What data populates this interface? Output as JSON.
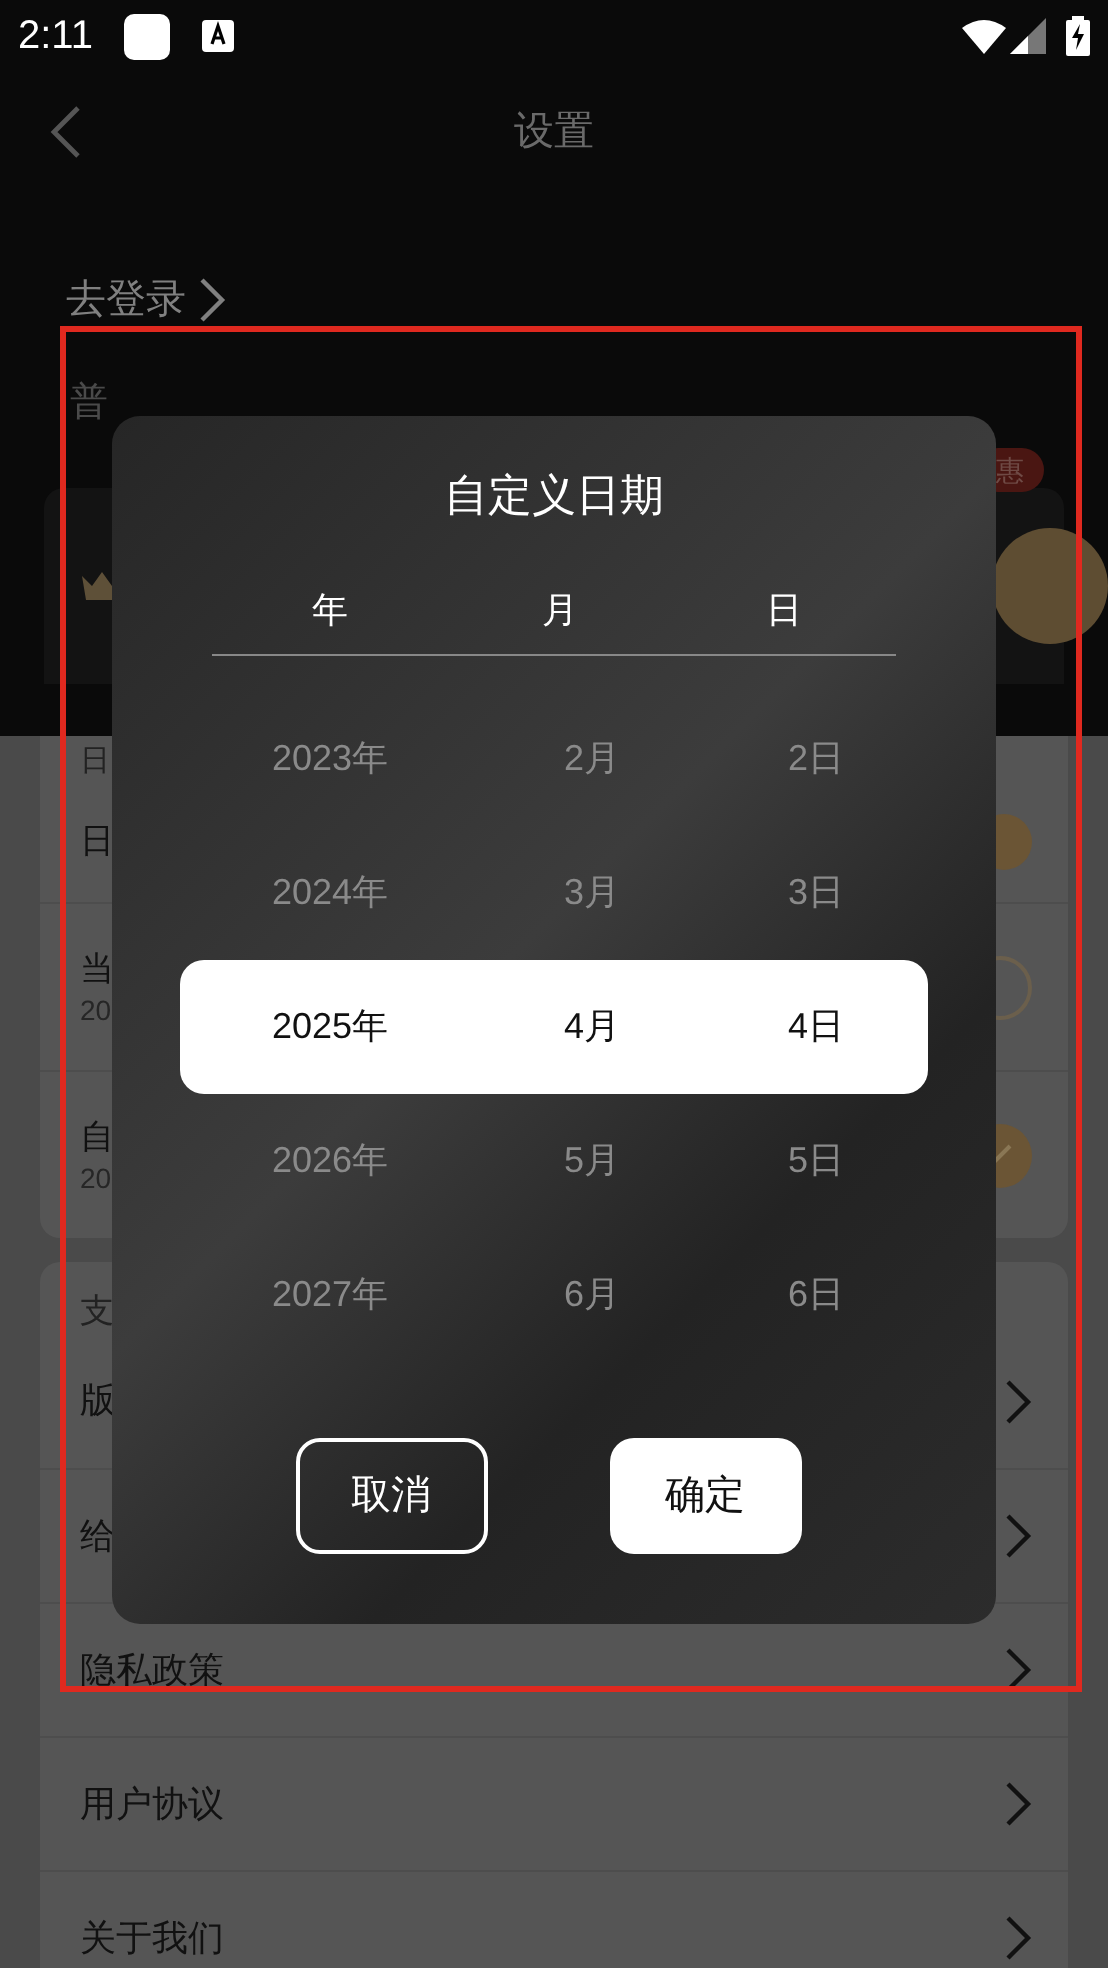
{
  "status_bar": {
    "time": "2:11"
  },
  "header": {
    "title": "设置"
  },
  "login_link": "去登录",
  "section_label": "普",
  "promo_badge": "惠",
  "date_section": {
    "label": "日",
    "rows": [
      {
        "title": "日",
        "kind": "switch",
        "on": true
      },
      {
        "title": "当",
        "subtitle": "20",
        "kind": "radio",
        "selected": false
      },
      {
        "title": "自",
        "subtitle": "20",
        "kind": "radio",
        "selected": true
      }
    ]
  },
  "support_section": {
    "label": "支",
    "items": [
      "版",
      "给",
      "隐私政策",
      "用户协议",
      "关于我们"
    ]
  },
  "dialog": {
    "title": "自定义日期",
    "columns": [
      "年",
      "月",
      "日"
    ],
    "rows": [
      {
        "year": "2023年",
        "month": "2月",
        "day": "2日",
        "selected": false
      },
      {
        "year": "2024年",
        "month": "3月",
        "day": "3日",
        "selected": false
      },
      {
        "year": "2025年",
        "month": "4月",
        "day": "4日",
        "selected": true
      },
      {
        "year": "2026年",
        "month": "5月",
        "day": "5日",
        "selected": false
      },
      {
        "year": "2027年",
        "month": "6月",
        "day": "6日",
        "selected": false
      }
    ],
    "buttons": [
      {
        "label": "取消",
        "kind": "outline"
      },
      {
        "label": "确定",
        "kind": "filled"
      }
    ]
  }
}
